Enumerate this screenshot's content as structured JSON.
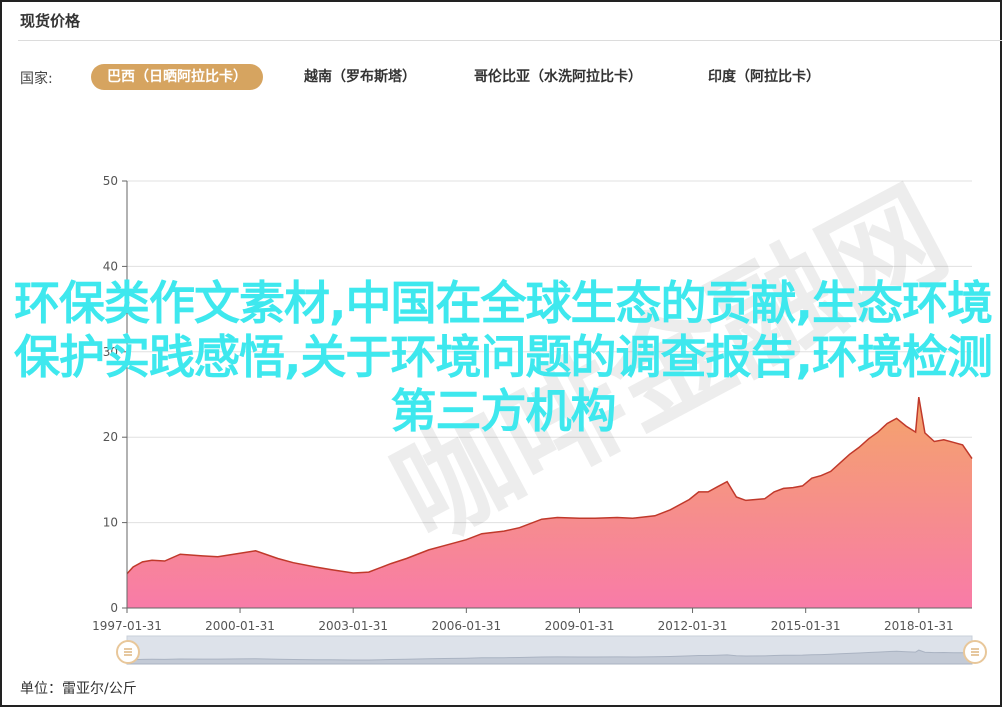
{
  "header": {
    "title": "现货价格"
  },
  "filter": {
    "label": "国家:",
    "tabs": [
      {
        "label": "巴西（日晒阿拉比卡）",
        "active": true
      },
      {
        "label": "越南（罗布斯塔）",
        "active": false
      },
      {
        "label": "哥伦比亚（水洗阿拉比卡）",
        "active": false
      },
      {
        "label": "印度（阿拉比卡）",
        "active": false
      }
    ]
  },
  "overlay": {
    "text": "环保类作文素材,中国在全球生态的贡献,生态环境保护实践感悟,关于环境问题的调查报告,环境检测第三方机构"
  },
  "watermark": {
    "text": "咖啡金融网"
  },
  "footer": {
    "unit": "单位：雷亚尔/公斤"
  },
  "colors": {
    "accent": "#d6a460",
    "area_top": "#f4a46a",
    "area_bottom": "#f87ba8",
    "line": "#c0392b",
    "overlay": "#3ee8ee"
  },
  "chart_data": {
    "type": "area",
    "title": "",
    "xlabel": "",
    "ylabel": "",
    "ylim": [
      0,
      50
    ],
    "yticks": [
      0,
      10,
      20,
      30,
      40,
      50
    ],
    "xlim": [
      "1997-01-31",
      "2019-06-30"
    ],
    "xtick_labels": [
      "1997-01-31",
      "2000-01-31",
      "2003-01-31",
      "2006-01-31",
      "2009-01-31",
      "2012-01-31",
      "2015-01-31",
      "2018-01-31"
    ],
    "grid": true,
    "series": [
      {
        "x": [
          "1997-01-31",
          "1997-03-31",
          "1997-06-30",
          "1997-09-30",
          "1998-01-31",
          "1998-06-30",
          "1999-01-31",
          "1999-06-30",
          "2000-01-31",
          "2000-06-30",
          "2001-01-31",
          "2001-06-30",
          "2002-01-31",
          "2002-06-30",
          "2003-01-31",
          "2003-06-30",
          "2004-01-31",
          "2004-06-30",
          "2005-01-31",
          "2005-06-30",
          "2006-01-31",
          "2006-06-30",
          "2007-01-31",
          "2007-06-30",
          "2008-01-31",
          "2008-06-30",
          "2009-01-31",
          "2009-06-30",
          "2010-01-31",
          "2010-06-30",
          "2011-01-31",
          "2011-06-30",
          "2011-12-31",
          "2012-03-31",
          "2012-06-30",
          "2012-09-30",
          "2012-12-31",
          "2013-03-31",
          "2013-06-30",
          "2013-12-31",
          "2014-03-31",
          "2014-06-30",
          "2014-09-30",
          "2014-12-31",
          "2015-03-31",
          "2015-06-30",
          "2015-09-30",
          "2015-12-31",
          "2016-03-31",
          "2016-06-30",
          "2016-09-30",
          "2016-12-31",
          "2017-03-31",
          "2017-06-30",
          "2017-09-30",
          "2017-12-31",
          "2018-01-31",
          "2018-03-31",
          "2018-06-30",
          "2018-09-30",
          "2018-12-31",
          "2019-03-31",
          "2019-06-30"
        ],
        "values": [
          4.0,
          4.8,
          5.4,
          5.6,
          5.5,
          6.3,
          6.1,
          6.0,
          6.4,
          6.7,
          5.8,
          5.3,
          4.8,
          4.5,
          4.1,
          4.2,
          5.2,
          5.8,
          6.8,
          7.3,
          8.0,
          8.7,
          9.0,
          9.4,
          10.4,
          10.6,
          10.5,
          10.5,
          10.6,
          10.5,
          10.8,
          11.5,
          12.7,
          13.6,
          13.6,
          14.2,
          14.8,
          13.0,
          12.6,
          12.8,
          13.6,
          14.0,
          14.1,
          14.3,
          15.2,
          15.5,
          16.0,
          17.0,
          18.0,
          18.8,
          19.8,
          20.6,
          21.6,
          22.2,
          21.3,
          20.6,
          24.7,
          20.5,
          19.5,
          19.7,
          19.4,
          19.1,
          17.5
        ]
      }
    ]
  }
}
